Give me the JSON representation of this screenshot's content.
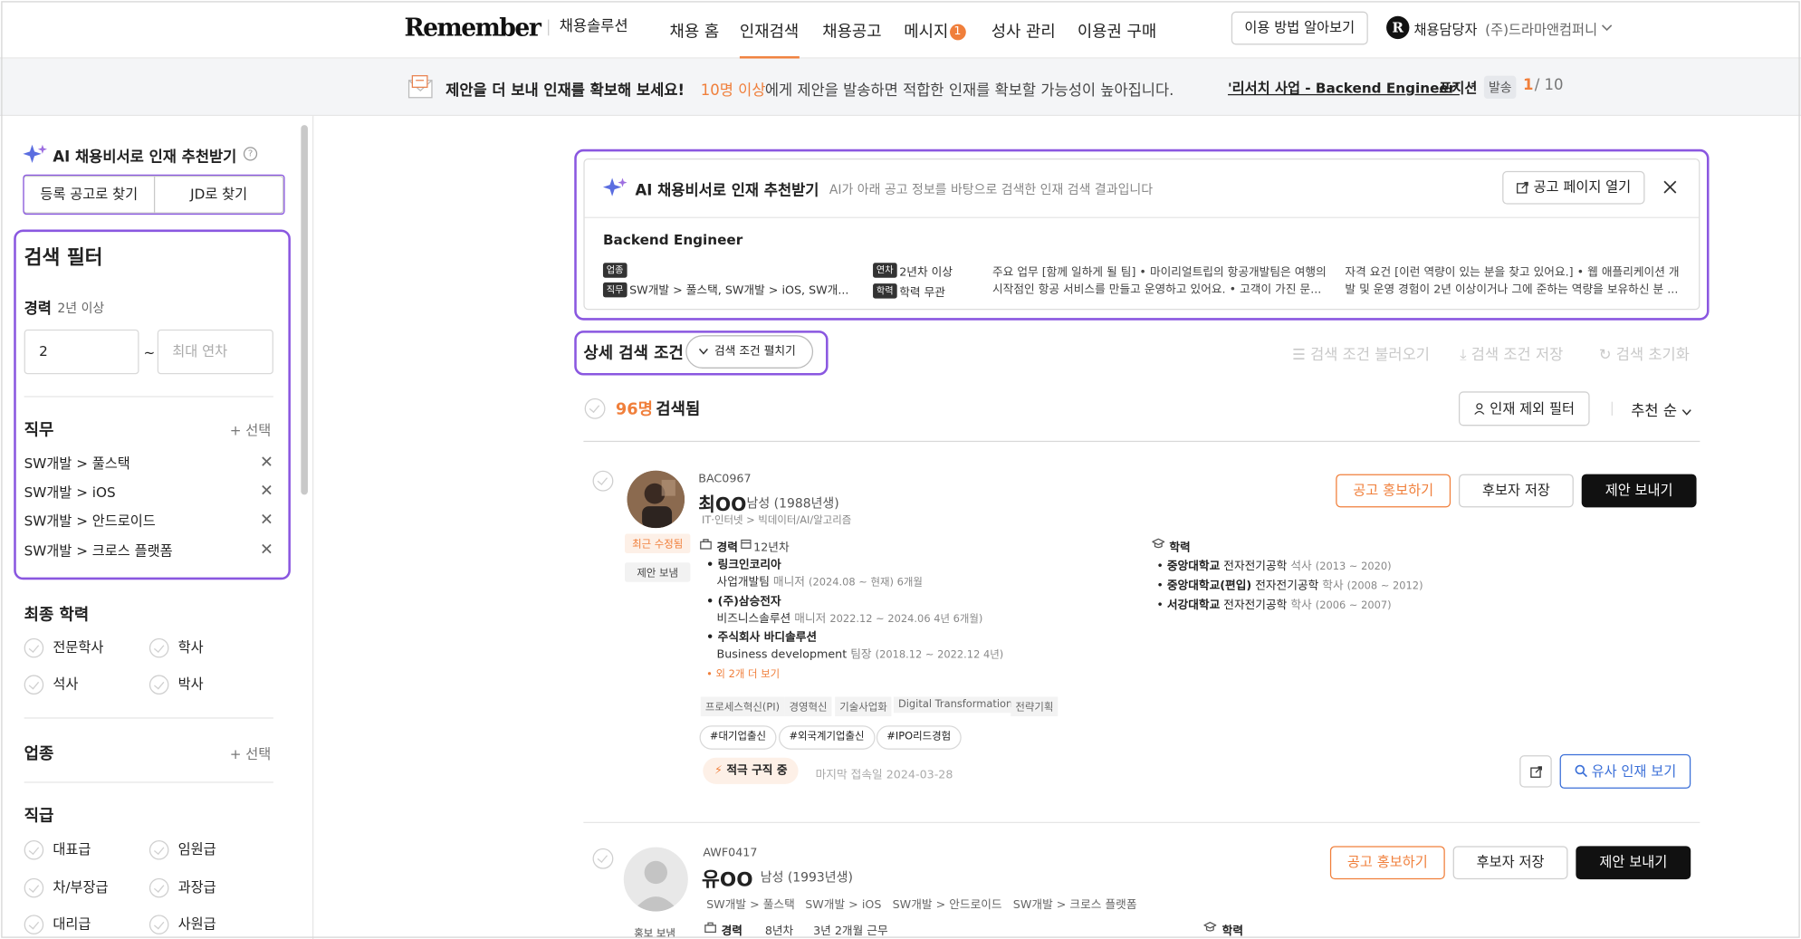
{
  "header": {
    "logo": "Remember",
    "logo_sub": "채용솔루션",
    "nav": [
      {
        "label": "채용 홈"
      },
      {
        "label": "인재검색"
      },
      {
        "label": "채용공고"
      },
      {
        "label": "메시지",
        "badge": "1"
      },
      {
        "label": "성사 관리"
      },
      {
        "label": "이용권 구매"
      }
    ],
    "howto_btn": "이용 방법 알아보기",
    "user": "채용담당자",
    "company": "(주)드라마앤컴퍼니"
  },
  "banner": {
    "title": "제안을 더 보내 인재를 확보해 보세요!",
    "highlight": "10명 이상",
    "message": "에게 제안을 발송하면 적합한 인재를 확보할 가능성이 높아집니다.",
    "position_link": "'리서치 사업 - Backend Engineer'",
    "position_suffix": "포지션",
    "sent_label": "발송",
    "sent_count": "1",
    "sent_total": "/ 10"
  },
  "sidebar": {
    "ai_title": "AI 채용비서로 인재 추천받기",
    "tab_posting": "등록 공고로 찾기",
    "tab_jd": "JD로 찾기",
    "filter_title": "검색 필터",
    "career_label": "경력",
    "career_sub": "2년 이상",
    "career_min": "2",
    "career_tilde": "~",
    "career_max_placeholder": "최대 연차",
    "job_label": "직무",
    "add_label": "+ 선택",
    "jobs": [
      "SW개발 > 풀스택",
      "SW개발 > iOS",
      "SW개발 > 안드로이드",
      "SW개발 > 크로스 플랫폼"
    ],
    "edu_label": "최종 학력",
    "edu_options": [
      "전문학사",
      "학사",
      "석사",
      "박사"
    ],
    "industry_label": "업종",
    "rank_label": "직급",
    "rank_options": [
      "대표급",
      "임원급",
      "차/부장급",
      "과장급",
      "대리급",
      "사원급"
    ]
  },
  "ai_card": {
    "title": "AI 채용비서로 인재 추천받기",
    "desc": "AI가 아래 공고 정보를 바탕으로 검색한 인재 검색 결과입니다",
    "open_btn": "공고 페이지 열기",
    "position": "Backend Engineer",
    "tag_industry": "업종",
    "tag_job": "직무",
    "job_value": "SW개발 > 풀스택, SW개발 > iOS, SW개...",
    "tag_years": "연차",
    "years_value": "2년차 이상",
    "tag_edu": "학력",
    "edu_value": "학력 무관",
    "duty_1": "주요 업무 [함께 일하게 될 팀] • 마이리얼트립의 항공개발팀은 여행의",
    "duty_2": "시작점인 항공 서비스를 만들고 운영하고 있어요. • 고객이 가진 문...",
    "req_1": "자격 요건 [이런 역량이 있는 분을 찾고 있어요.] • 웹 애플리케이션 개",
    "req_2": "발 및 운영 경험이 2년 이상이거나 그에 준하는 역량을 보유하신 분 ..."
  },
  "detail": {
    "title": "상세 검색 조건",
    "expand_btn": "검색 조건 펼치기",
    "load": "검색 조건 불러오기",
    "save": "검색 조건 저장",
    "reset": "검색 초기화"
  },
  "results": {
    "count": "96명",
    "count_suffix": "검색됨",
    "exclude_btn": "인재 제외 필터",
    "sort": "추천 순"
  },
  "candidates": [
    {
      "id": "BAC0967",
      "name": "최OO",
      "gender_age": "남성 (1988년생)",
      "field": "IT·인터넷 > 빅데이터/AI/알고리즘",
      "badge_recent": "최근 수정됨",
      "badge_offer": "제안 보냄",
      "career_label": "경력",
      "career_years": "12년차",
      "jobs": [
        {
          "company": "링크인코리아",
          "team": "사업개발팀",
          "role": "매니저",
          "period": "(2024.08 ~ 현재) 6개월"
        },
        {
          "company": "(주)삼승전자",
          "team": "비즈니스솔루션",
          "role": "매니저",
          "period": "2022.12 ~ 2024.06 4년 6개월)"
        },
        {
          "company": "주식회사 바디솔루션",
          "team": "Business development",
          "role": "팀장",
          "period": "(2018.12 ~ 2022.12 4년)"
        }
      ],
      "more": "외 2개 더 보기",
      "edu_label": "학력",
      "edu": [
        {
          "school": "중앙대학교",
          "major": "전자전기공학",
          "degree": "석사",
          "period": "(2013 ~ 2020)"
        },
        {
          "school": "중앙대학교(편입)",
          "major": "전자전기공학",
          "degree": "학사",
          "period": "(2008 ~ 2012)"
        },
        {
          "school": "서강대학교",
          "major": "전자전기공학",
          "degree": "학사",
          "period": "(2006 ~ 2007)"
        }
      ],
      "keywords": [
        "프로세스혁신(PI)",
        "경영혁신",
        "기술사업화",
        "Digital Transformation",
        "전략기획"
      ],
      "hashtags": [
        "#대기업출신",
        "#외국계기업출신",
        "#IPO리드경험"
      ],
      "status": "적극 구직 중",
      "last_login": "마지막 접속일 2024-03-28",
      "btn_promo": "공고 홍보하기",
      "btn_save": "후보자 저장",
      "btn_offer": "제안 보내기",
      "btn_similar": "유사 인재 보기"
    },
    {
      "id": "AWF0417",
      "name": "유OO",
      "gender_age": "남성 (1993년생)",
      "skills": [
        "SW개발 > 풀스택",
        "SW개발 > iOS",
        "SW개발 > 안드로이드",
        "SW개발 > 크로스 플랫폼"
      ],
      "badge": "홍보 보냄",
      "career_label": "경력",
      "career_years": "8년차",
      "career_extra": "3년 2개월 근무",
      "edu_label": "학력",
      "btn_promo": "공고 홍보하기",
      "btn_save": "후보자 저장",
      "btn_offer": "제안 보내기"
    }
  ],
  "colors": {
    "accent": "#f07f3b",
    "highlight": "#8a57e0",
    "link": "#3a6fd8"
  }
}
